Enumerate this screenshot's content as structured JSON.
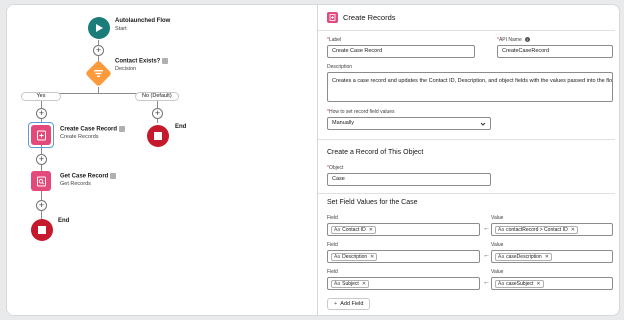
{
  "flow": {
    "start": {
      "title": "Autolaunched Flow",
      "subtitle": "Start"
    },
    "decision": {
      "title": "Contact Exists?",
      "subtitle": "Decision"
    },
    "branches": {
      "yes": "Yes",
      "no": "No (Default)"
    },
    "create_node": {
      "title": "Create Case Record",
      "subtitle": "Create Records"
    },
    "get_node": {
      "title": "Get Case Record",
      "subtitle": "Get Records"
    },
    "end_label": "End",
    "add_symbol": "+"
  },
  "panel": {
    "title": "Create Records",
    "label_field": {
      "label": "Label",
      "value": "Create Case Record"
    },
    "api_field": {
      "label": "API Name",
      "value": "CreateCaseRecord",
      "info": "i"
    },
    "description": {
      "label": "Description",
      "value": "Creates a case record and updates the Contact ID, Description, and object fields with the values passed into the flow."
    },
    "how_to_set": {
      "label": "How to set record field values",
      "value": "Manually"
    },
    "section_object": "Create a Record of This Object",
    "object_field": {
      "label": "Object",
      "value": "Case"
    },
    "section_fields": "Set Field Values for the Case",
    "field_label": "Field",
    "value_label": "Value",
    "rows": [
      {
        "field": "Contact ID",
        "value": "contactRecord > Contact ID"
      },
      {
        "field": "Description",
        "value": "caseDescription"
      },
      {
        "field": "Subject",
        "value": "caseSubject"
      }
    ],
    "add_field": "Add Field",
    "resource_badge": "Aa",
    "remove_symbol": "✕",
    "arrow_symbol": "←",
    "required_mark": "*"
  },
  "colors": {
    "start": "#1b7d7a",
    "decision": "#ff9a3c",
    "create": "#e3497a",
    "end": "#c5192d",
    "link": "#0176d3"
  }
}
